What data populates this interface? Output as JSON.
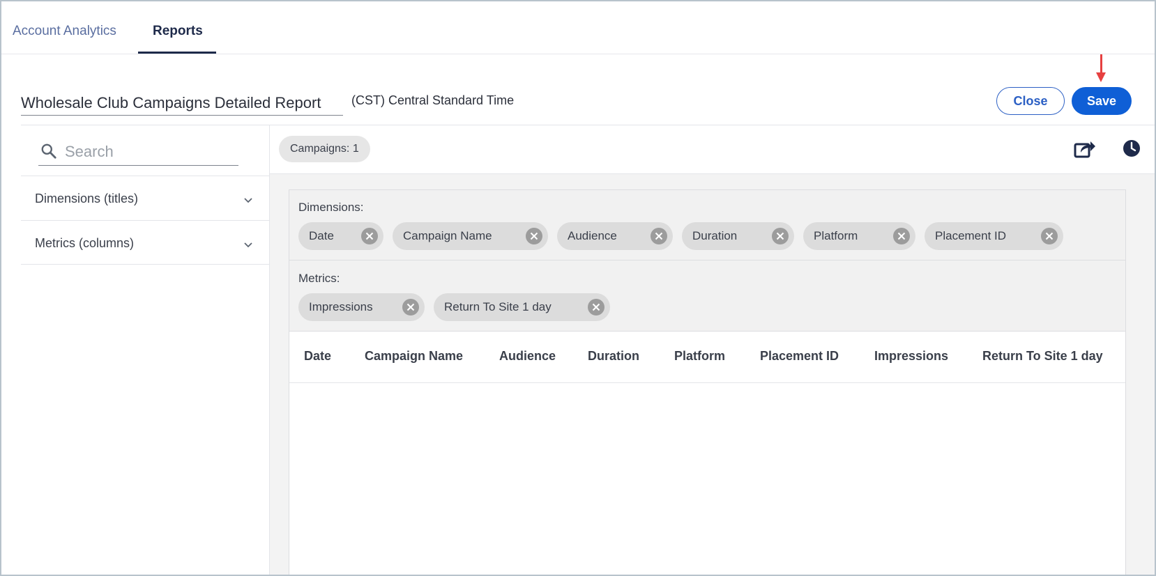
{
  "tabs": [
    {
      "label": "Account Analytics",
      "active": false
    },
    {
      "label": "Reports",
      "active": true
    }
  ],
  "header": {
    "report_name": "Wholesale Club Campaigns Detailed Report",
    "timezone": "(CST) Central Standard Time",
    "close_label": "Close",
    "save_label": "Save"
  },
  "sidebar": {
    "search_placeholder": "Search",
    "sections": [
      {
        "label": "Dimensions (titles)"
      },
      {
        "label": "Metrics (columns)"
      }
    ]
  },
  "main": {
    "campaigns_chip": "Campaigns: 1",
    "dimensions_label": "Dimensions:",
    "dimensions": [
      "Date",
      "Campaign Name",
      "Audience",
      "Duration",
      "Platform",
      "Placement ID"
    ],
    "metrics_label": "Metrics:",
    "metrics": [
      "Impressions",
      "Return To Site 1 day"
    ],
    "table_headers": [
      "Date",
      "Campaign Name",
      "Audience",
      "Duration",
      "Platform",
      "Placement ID",
      "Impressions",
      "Return To Site 1 day"
    ]
  },
  "colors": {
    "primary": "#0f5fd6",
    "tab_active": "#1e2a4a",
    "annotation_arrow": "#e64040"
  },
  "icons": {
    "search": "search-icon",
    "chevron": "chevron-down-icon",
    "share": "share-icon",
    "clock": "clock-icon",
    "remove": "close-circle-icon"
  }
}
